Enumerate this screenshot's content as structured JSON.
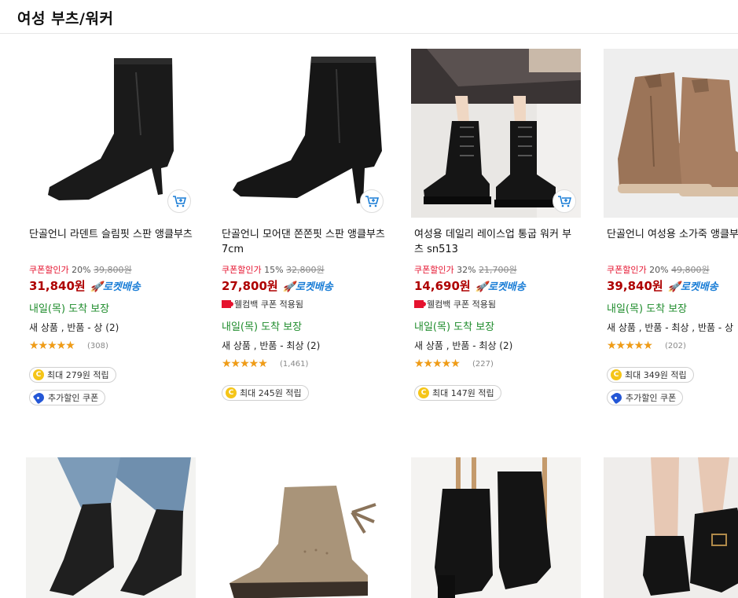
{
  "category": {
    "title": "여성 부츠/워커"
  },
  "labels": {
    "coupon_label": "쿠폰할인가",
    "rocket": "🚀로켓배송",
    "welcome_coupon": "웰컴백 쿠폰 적용됨",
    "extra_coupon": "추가할인 쿠폰",
    "points_prefix": "최대",
    "points_suffix": "적립"
  },
  "products": [
    {
      "name": "단골언니 라덴트 슬림핏 스판 앵클부츠",
      "discount": "20%",
      "original_price": "39,800원",
      "price": "31,840원",
      "delivery": "내일(목) 도착 보장",
      "condition": "새 상품 , 반품 - 상 (2)",
      "rating": 4.5,
      "review_count": "(308)",
      "points": "최대 279원 적립",
      "welcome": false,
      "extra_coupon": true,
      "image": "black-ankle-boot-icon"
    },
    {
      "name": "단골언니 모어댄 쫀쫀핏 스판 앵클부츠 7cm",
      "discount": "15%",
      "original_price": "32,800원",
      "price": "27,800원",
      "delivery": "내일(목) 도착 보장",
      "condition": "새 상품 , 반품 - 최상 (2)",
      "rating": 4.5,
      "review_count": "(1,461)",
      "points": "최대 245원 적립",
      "welcome": true,
      "extra_coupon": false,
      "image": "black-heel-boot-icon"
    },
    {
      "name": "여성용 데일리 레이스업 통굽 워커 부츠 sn513",
      "discount": "32%",
      "original_price": "21,700원",
      "price": "14,690원",
      "delivery": "내일(목) 도착 보장",
      "condition": "새 상품 , 반품 - 최상 (2)",
      "rating": 4.5,
      "review_count": "(227)",
      "points": "최대 147원 적립",
      "welcome": true,
      "extra_coupon": false,
      "image": "combat-boot-icon"
    },
    {
      "name": "단골언니 여성용 소가죽 앵클부츠 지퍼",
      "discount": "20%",
      "original_price": "49,800원",
      "price": "39,840원",
      "delivery": "내일(목) 도착 보장",
      "condition": "새 상품 , 반품 - 최상 , 반품 - 상",
      "rating": 4.5,
      "review_count": "(202)",
      "points": "최대 349원 적립",
      "welcome": false,
      "extra_coupon": true,
      "image": "suede-chelsea-boot-icon"
    }
  ],
  "row2_images": [
    "sock-boot-icon",
    "beige-bow-boot-icon",
    "black-block-heel-boot-icon",
    "black-buckle-boot-icon"
  ],
  "colors": {
    "price": "#ae0000",
    "coupon": "#e5122e",
    "rocket": "#1a7dd6",
    "delivery": "#1f8c2c",
    "star": "#f09c16"
  }
}
